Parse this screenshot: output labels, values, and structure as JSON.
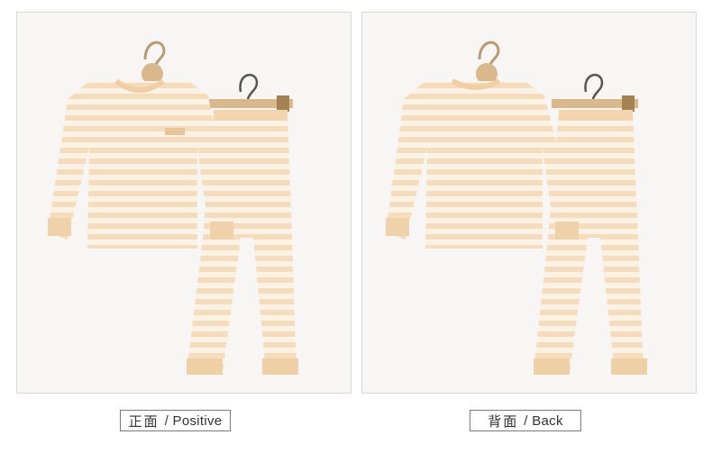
{
  "panels": [
    {
      "caption_cn": "正面",
      "caption_en": "/ Positive"
    },
    {
      "caption_cn": "背面",
      "caption_en": "/ Back"
    }
  ],
  "colors": {
    "background": "#f7f6f4",
    "fabric": "#f6e0c2",
    "stripe": "#fbf1e3",
    "hanger_wood": "#d8b88c",
    "tag": "#a48253"
  }
}
